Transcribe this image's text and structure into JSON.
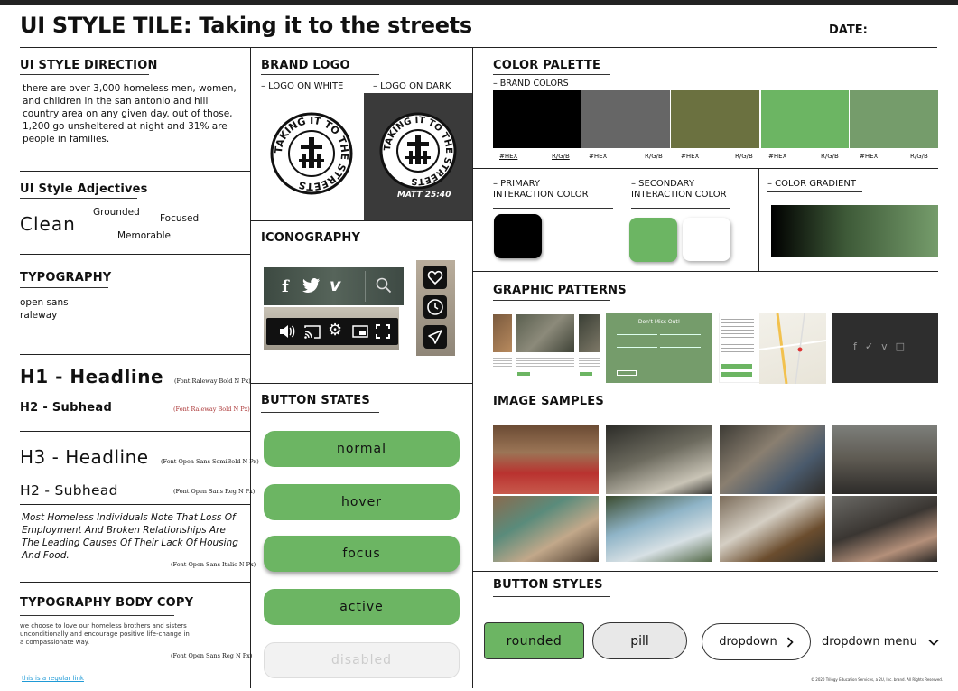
{
  "header": {
    "title": "UI STYLE TILE: Taking it to the streets",
    "date_label": "DATE:"
  },
  "style_direction": {
    "heading": "UI STYLE DIRECTION",
    "text": "there are over 3,000 homeless men, women, and children in the san antonio and hill country area on any given day. out of those, 1,200 go unsheltered at night and 31% are people in families."
  },
  "adjectives": {
    "heading": "UI Style Adjectives",
    "words": [
      "Clean",
      "Grounded",
      "Focused",
      "Memorable"
    ]
  },
  "typography": {
    "heading": "TYPOGRAPHY",
    "fonts": [
      "open sans",
      "raleway"
    ],
    "h1": "H1 - Headline",
    "h1_note": "(Font Raleway Bold N Px)",
    "h2": "H2 - Subhead",
    "h2_note": "(Font Raleway  Bold N Px)",
    "h3": "H3 - Headline",
    "h3_note": "(Font Open Sans SemiBold N Px)",
    "h2b": "H2 - Subhead",
    "h2b_note": "(Font Open Sans Reg  N Px)",
    "quote": "Most Homeless Individuals Note That Loss Of Employment And Broken Relationships Are The Leading Causes Of Their Lack Of Housing And Food.",
    "quote_note": "(Font Open Sans Italic N Px)"
  },
  "body_copy": {
    "heading": "TYPOGRAPHY BODY COPY",
    "text": "we choose to love our homeless brothers and sisters unconditionally and encourage positive life-change in a compassionate way.",
    "note": "(Font Open Sans  Reg N Px)",
    "link": "this is a regular link"
  },
  "brand_logo": {
    "heading": "BRAND LOGO",
    "on_white": "– LOGO ON WHITE",
    "on_dark": "– LOGO ON DARK",
    "logo_text": "TAKING IT TO THE STREETS",
    "verse": "MATT 25:40"
  },
  "iconography": {
    "heading": "ICONOGRAPHY",
    "social_icons": [
      "facebook-icon",
      "twitter-icon",
      "vimeo-icon",
      "search-icon"
    ],
    "media_icons": [
      "volume-icon",
      "cast-icon",
      "settings-icon",
      "pip-icon",
      "fullscreen-icon"
    ],
    "side_icons": [
      "heart-icon",
      "clock-icon",
      "send-icon"
    ]
  },
  "button_states": {
    "heading": "BUTTON STATES",
    "buttons": [
      "normal",
      "hover",
      "focus",
      "active",
      "disabled"
    ]
  },
  "color_palette": {
    "heading": "COLOR PALETTE",
    "brand_label": "– BRAND COLORS",
    "colors": [
      "#000000",
      "#666666",
      "#6b7140",
      "#6cb563",
      "#759c6b"
    ],
    "hex_label": "#HEX",
    "rgb_label": "R/G/B"
  },
  "interaction": {
    "primary_label": "– PRIMARY INTERACTION COLOR",
    "secondary_label": "– SECONDARY INTERACTION COLOR",
    "gradient_label": "– COLOR GRADIENT",
    "primary_color": "#000000",
    "secondary_colors": [
      "#6cb563",
      "#ffffff"
    ]
  },
  "patterns": {
    "heading": "GRAPHIC PATTERNS",
    "form_title": "Don't Miss Out!"
  },
  "images": {
    "heading": "IMAGE SAMPLES"
  },
  "button_styles": {
    "heading": "BUTTON STYLES",
    "rounded": "rounded",
    "pill": "pill",
    "dropdown": "dropdown",
    "dropdown_menu": "dropdown menu"
  },
  "footer": {
    "copyright": "© 2020 Trilogy Education Services, a 2U, Inc. brand. All Rights Reserved."
  }
}
